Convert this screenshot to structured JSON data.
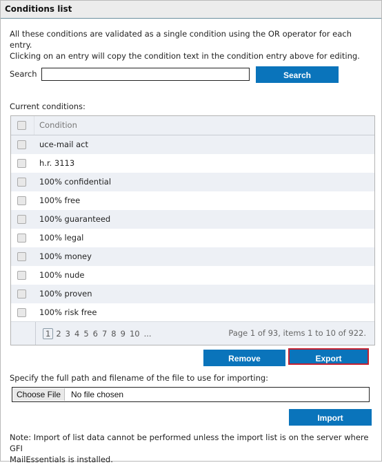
{
  "panel": {
    "title": "Conditions list",
    "intro_line1": "All these conditions are validated as a single condition using the OR operator for each entry.",
    "intro_line2": "Clicking on an entry will copy the condition text in the condition entry above for editing."
  },
  "search": {
    "label": "Search",
    "value": "",
    "placeholder": "",
    "button_label": "Search"
  },
  "conditions": {
    "label": "Current conditions:",
    "column_header": "Condition",
    "rows": [
      {
        "text": "uce-mail act",
        "checked": false
      },
      {
        "text": "h.r. 3113",
        "checked": false
      },
      {
        "text": "100% confidential",
        "checked": false
      },
      {
        "text": "100% free",
        "checked": false
      },
      {
        "text": "100% guaranteed",
        "checked": false
      },
      {
        "text": "100% legal",
        "checked": false
      },
      {
        "text": "100% money",
        "checked": false
      },
      {
        "text": "100% nude",
        "checked": false
      },
      {
        "text": "100% proven",
        "checked": false
      },
      {
        "text": "100% risk free",
        "checked": false
      }
    ],
    "pager": {
      "pages": [
        "1",
        "2",
        "3",
        "4",
        "5",
        "6",
        "7",
        "8",
        "9",
        "10",
        "..."
      ],
      "current_page": "1",
      "info": "Page 1 of 93, items 1 to 10 of 922."
    }
  },
  "actions": {
    "remove_label": "Remove",
    "export_label": "Export"
  },
  "import": {
    "label": "Specify the full path and filename of the file to use for importing:",
    "choose_file_label": "Choose File",
    "file_status": "No file chosen",
    "import_label": "Import",
    "note_line1": "Note: Import of list data cannot be performed unless the import list is on the server where GFI",
    "note_line2": "MailEssentials is installed."
  },
  "colors": {
    "button_blue": "#0a74bb",
    "highlight_red": "#c4202f",
    "row_alt": "#edf0f5"
  }
}
